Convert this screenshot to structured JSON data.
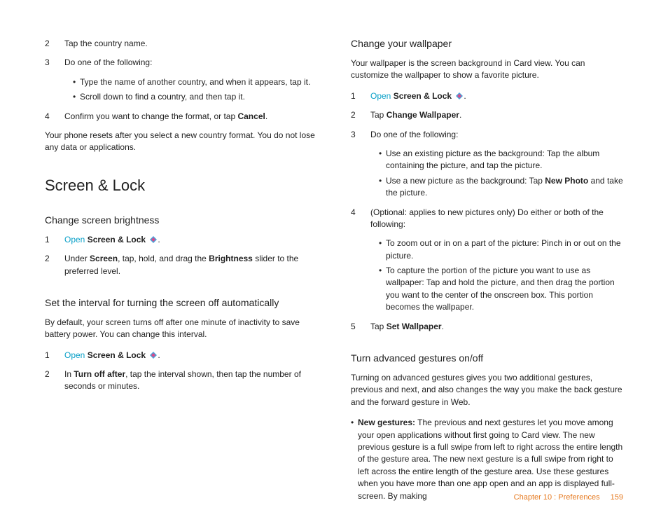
{
  "left": {
    "step2": {
      "num": "2",
      "text": "Tap the country name."
    },
    "step3": {
      "num": "3",
      "text": "Do one of the following:"
    },
    "step3_bullets": [
      "Type the name of another country, and when it appears, tap it.",
      "Scroll down to find a country, and then tap it."
    ],
    "step4": {
      "num": "4",
      "pre": "Confirm you want to change the format, or tap ",
      "bold": "Cancel",
      "post": "."
    },
    "reset_note": "Your phone resets after you select a new country format. You do not lose any data or applications.",
    "section_title": "Screen & Lock",
    "brightness": {
      "heading": "Change screen brightness",
      "s1": {
        "num": "1",
        "open": "Open",
        "app": "Screen & Lock",
        "tail": "."
      },
      "s2": {
        "num": "2",
        "t1": "Under ",
        "b1": "Screen",
        "t2": ", tap, hold, and drag the ",
        "b2": "Brightness",
        "t3": " slider to the preferred level."
      }
    },
    "interval": {
      "heading": "Set the interval for turning the screen off automatically",
      "intro": "By default, your screen turns off after one minute of inactivity to save battery power. You can change this interval.",
      "s1": {
        "num": "1",
        "open": "Open",
        "app": "Screen & Lock",
        "tail": "."
      },
      "s2": {
        "num": "2",
        "t1": "In ",
        "b1": "Turn off after",
        "t2": ", tap the interval shown, then tap the number of seconds or minutes."
      }
    }
  },
  "right": {
    "wallpaper": {
      "heading": "Change your wallpaper",
      "intro": "Your wallpaper is the screen background in Card view. You can customize the wallpaper to show a favorite picture.",
      "s1": {
        "num": "1",
        "open": "Open",
        "app": "Screen & Lock",
        "tail": "."
      },
      "s2": {
        "num": "2",
        "t1": "Tap ",
        "b1": "Change Wallpaper",
        "t2": "."
      },
      "s3": {
        "num": "3",
        "text": "Do one of the following:"
      },
      "s3_bullets": [
        {
          "plain": "Use an existing picture as the background: Tap the album containing the picture, and tap the picture."
        },
        {
          "t1": "Use a new picture as the background: Tap ",
          "b": "New Photo",
          "t2": " and take the picture."
        }
      ],
      "s4": {
        "num": "4",
        "text": "(Optional: applies to new pictures only) Do either or both of the following:"
      },
      "s4_bullets": [
        "To zoom out or in on a part of the picture: Pinch in or out on the picture.",
        "To capture the portion of the picture you want to use as wallpaper: Tap and hold the picture, and then drag the portion you want to the center of the onscreen box. This portion becomes the wallpaper."
      ],
      "s5": {
        "num": "5",
        "t1": "Tap ",
        "b1": "Set Wallpaper",
        "t2": "."
      }
    },
    "gestures": {
      "heading": "Turn advanced gestures on/off",
      "intro": "Turning on advanced gestures gives you two additional gestures, previous and next, and also changes the way you make the back gesture and the forward gesture in Web.",
      "bullet": {
        "b": "New gestures:",
        "t": " The previous and next gestures let you move among your open applications without first going to Card view. The new previous gesture is a full swipe from left to right across the entire length of the gesture area. The new next gesture is a full swipe from right to left across the entire length of the gesture area. Use these gestures when you have more than one app open and an app is displayed full-screen. By making"
      }
    }
  },
  "footer": {
    "chapter": "Chapter 10 : Preferences",
    "page": "159"
  }
}
